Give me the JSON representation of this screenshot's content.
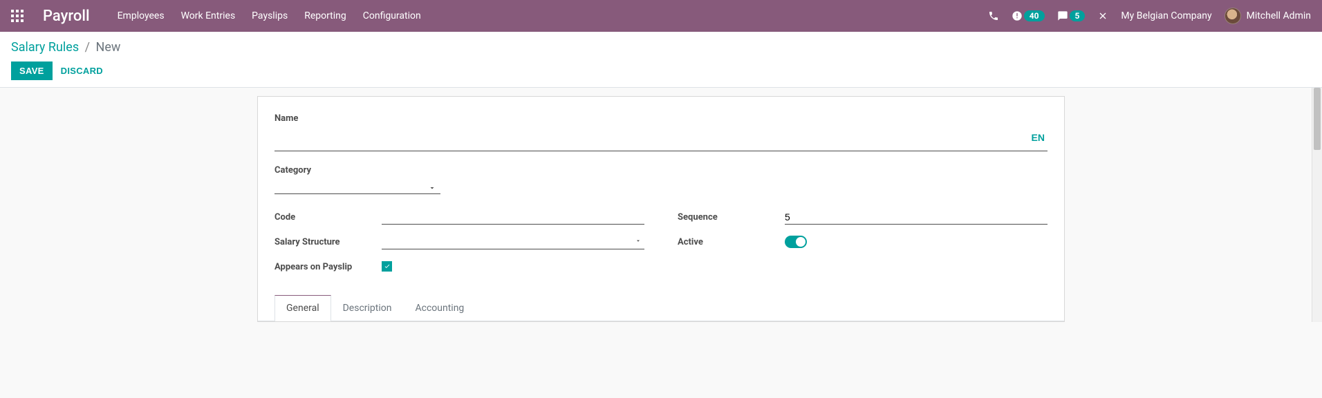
{
  "topbar": {
    "brand": "Payroll",
    "menu": [
      "Employees",
      "Work Entries",
      "Payslips",
      "Reporting",
      "Configuration"
    ],
    "activity_count": "40",
    "message_count": "5",
    "company": "My Belgian Company",
    "user": "Mitchell Admin"
  },
  "breadcrumb": {
    "parent": "Salary Rules",
    "current": "New"
  },
  "buttons": {
    "save": "SAVE",
    "discard": "DISCARD"
  },
  "form": {
    "name_label": "Name",
    "name_value": "",
    "lang_btn": "EN",
    "category_label": "Category",
    "category_value": "",
    "code_label": "Code",
    "code_value": "",
    "salary_structure_label": "Salary Structure",
    "salary_structure_value": "",
    "appears_label": "Appears on Payslip",
    "sequence_label": "Sequence",
    "sequence_value": "5",
    "active_label": "Active"
  },
  "tabs": [
    "General",
    "Description",
    "Accounting"
  ]
}
